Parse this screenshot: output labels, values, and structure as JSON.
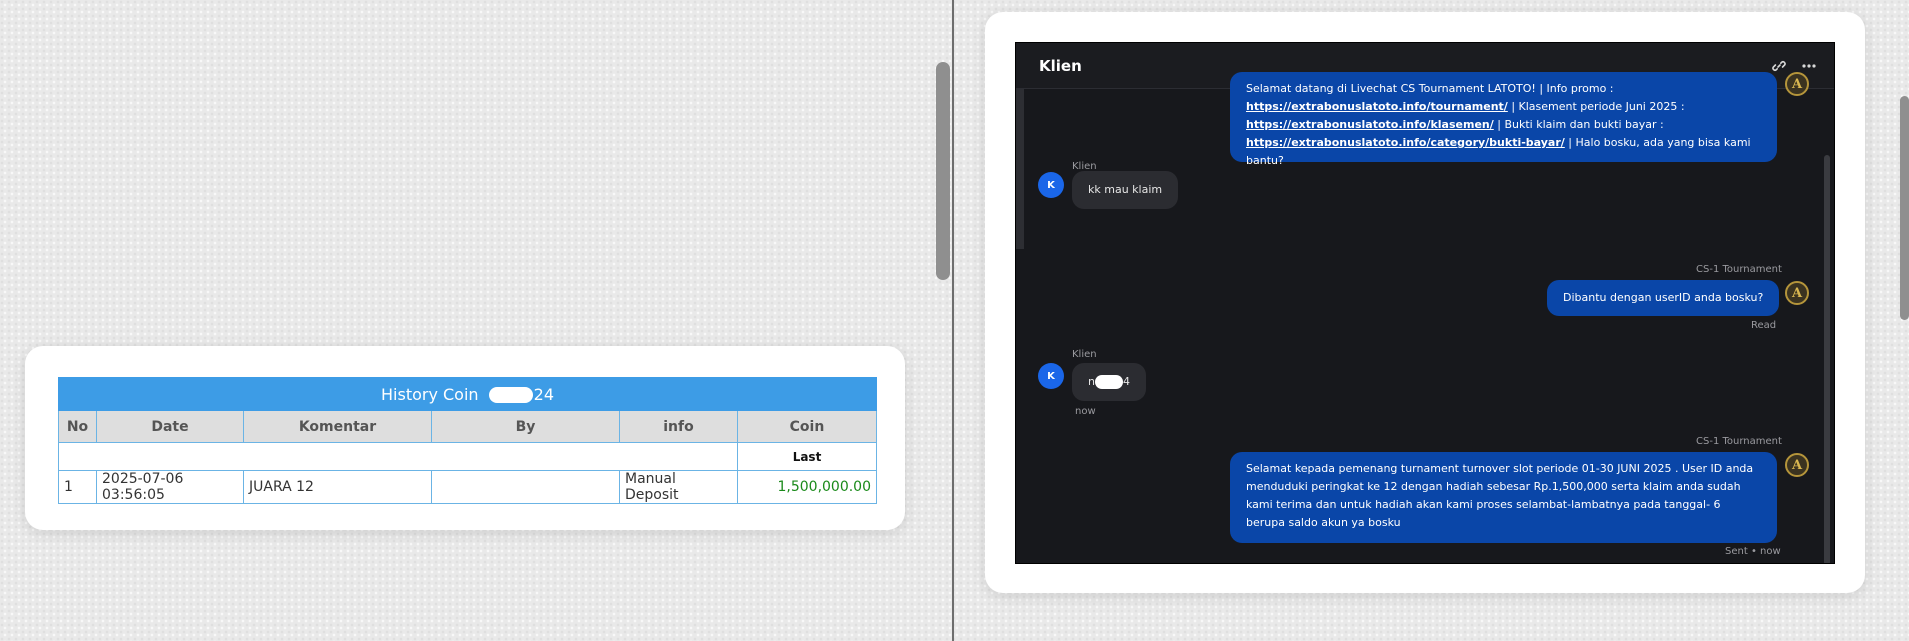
{
  "history": {
    "title_prefix": "History Coin ",
    "title_redacted_suffix": "24",
    "columns": [
      "No",
      "Date",
      "Komentar",
      "By",
      "info",
      "Coin"
    ],
    "subheader_last": "Last",
    "rows": [
      {
        "no": "1",
        "date": "2025-07-06 03:56:05",
        "komentar": "JUARA 12",
        "by": "",
        "info": "Manual Deposit",
        "coin": "1,500,000.00"
      }
    ]
  },
  "chat": {
    "title": "Klien",
    "header_icons": [
      "link-icon",
      "more-icon"
    ],
    "messages": [
      {
        "from": "agent",
        "text_1": "Selamat datang di Livechat CS Tournament LATOTO! | Info promo :",
        "link_1": "https://extrabonuslatoto.info/tournament/",
        "text_2": " | Klasement periode Juni 2025 :",
        "link_2": "https://extrabonuslatoto.info/klasemen/",
        "text_3": " | Bukti klaim dan bukti bayar :",
        "link_3": "https://extrabonuslatoto.info/category/bukti-bayar/",
        "text_4": " | Halo bosku, ada yang bisa kami bantu?"
      },
      {
        "from": "client",
        "sender": "Klien",
        "avatar": "K",
        "text": "kk mau klaim"
      },
      {
        "from": "agent",
        "sender": "CS-1 Tournament",
        "text": "Dibantu dengan userID anda bosku?",
        "status": "Read"
      },
      {
        "from": "client",
        "sender": "Klien",
        "avatar": "K",
        "text_prefix": "n",
        "text_suffix": "4",
        "time": "now"
      },
      {
        "from": "agent",
        "sender": "CS-1 Tournament",
        "text": "Selamat kepada pemenang turnament turnover slot periode 01-30 JUNI 2025 . User ID anda menduduki peringkat ke 12 dengan hadiah sebesar Rp.1,500,000 serta klaim anda sudah kami terima dan untuk hadiah akan kami proses selambat-lambatnya pada tanggal- 6 berupa saldo akun ya bosku",
        "status": "Sent • now"
      }
    ],
    "agent_avatar": "A"
  },
  "colors": {
    "table_header_blue": "#3d9ce6",
    "coin_green": "#1a8a1a",
    "chat_bg": "#17181c",
    "agent_bubble": "#0a46a8",
    "client_bubble": "#2b2c31",
    "client_avatar": "#1a66e8"
  }
}
